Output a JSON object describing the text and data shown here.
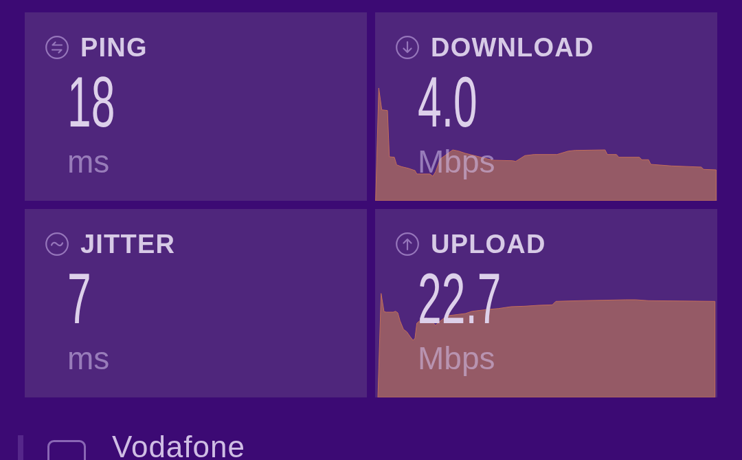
{
  "metrics": [
    {
      "kind": "ping",
      "label": "PING",
      "value": "18",
      "unit": "ms"
    },
    {
      "kind": "download",
      "label": "DOWNLOAD",
      "value": "4.0",
      "unit": "Mbps"
    },
    {
      "kind": "jitter",
      "label": "JITTER",
      "value": "7",
      "unit": "ms"
    },
    {
      "kind": "upload",
      "label": "UPLOAD",
      "value": "22.7",
      "unit": "Mbps"
    }
  ],
  "provider": {
    "name": "Vodafone"
  }
}
